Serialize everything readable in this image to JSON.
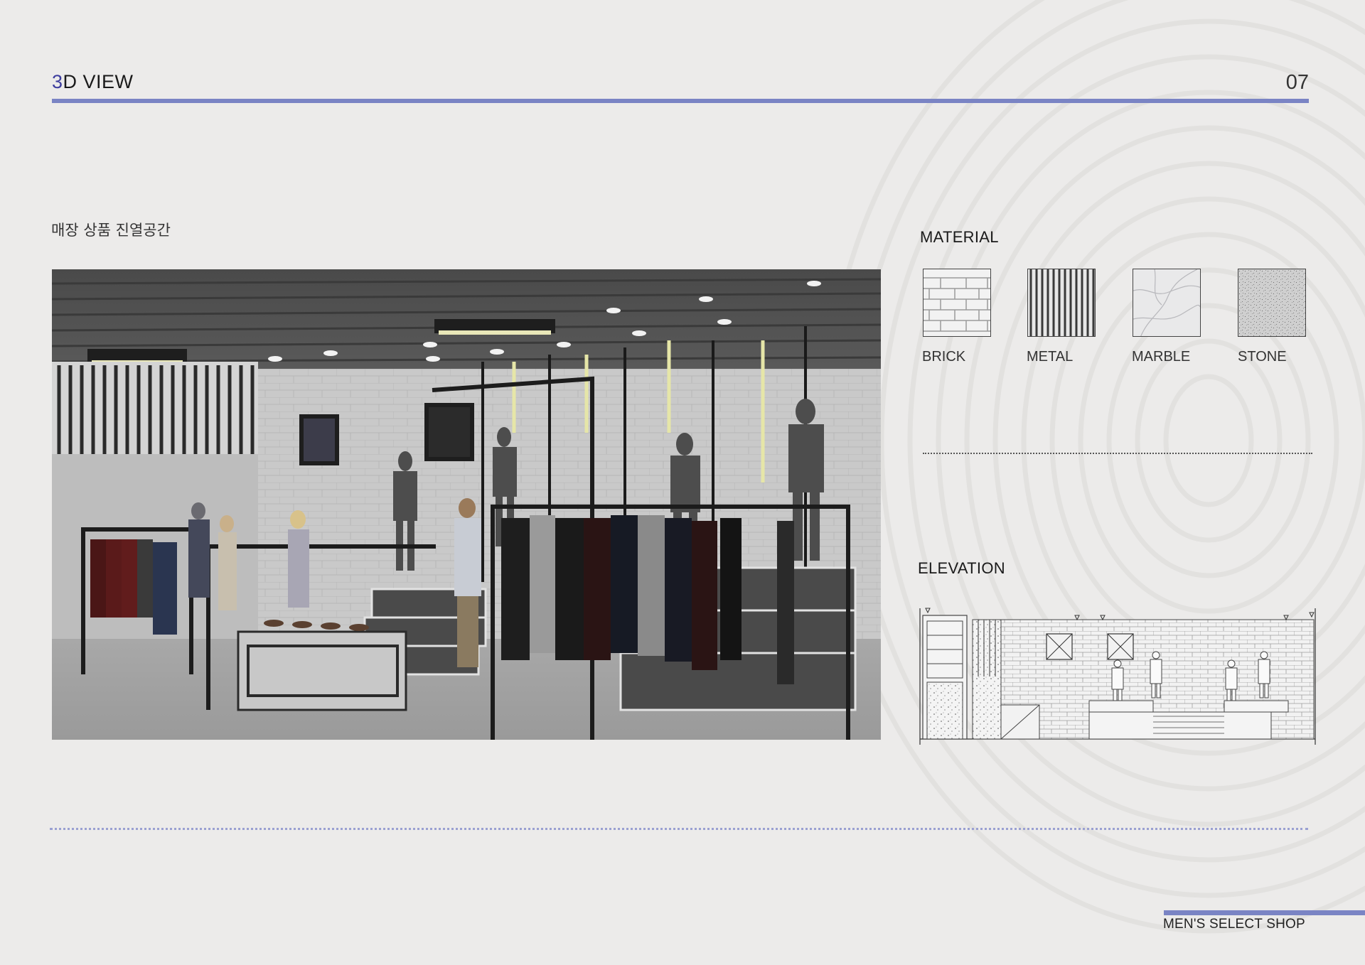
{
  "header": {
    "title_accent": "3",
    "title_rest": "D VIEW",
    "page_number": "07"
  },
  "subtitle": "매장 상품 진열공간",
  "material": {
    "heading": "MATERIAL",
    "swatches": [
      {
        "label": "BRICK"
      },
      {
        "label": "METAL"
      },
      {
        "label": "MARBLE"
      },
      {
        "label": "STONE"
      }
    ]
  },
  "elevation": {
    "heading": "ELEVATION"
  },
  "footer": {
    "text": "MEN'S SELECT SHOP"
  },
  "colors": {
    "accent": "#7a84c4",
    "background": "#ecebea"
  }
}
